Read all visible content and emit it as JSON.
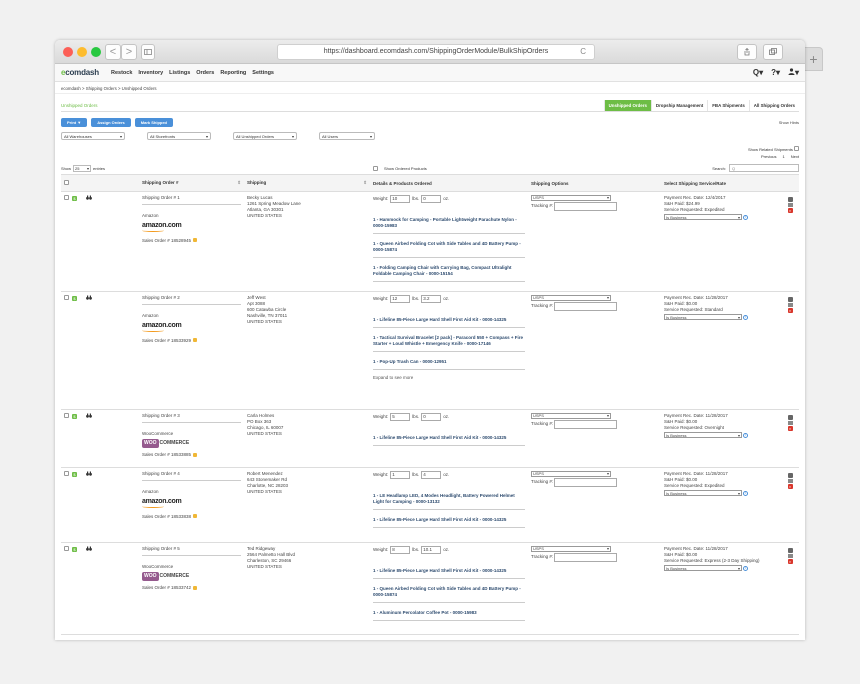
{
  "browser": {
    "url": "https://dashboard.ecomdash.com/ShippingOrderModule/BulkShipOrders",
    "back_icon": "<",
    "forward_icon": ">",
    "reload_icon": "C",
    "newtab_icon": "+"
  },
  "app": {
    "logo_prefix": "e",
    "logo_rest": "comdash",
    "menu": [
      "Restock",
      "Inventory",
      "Listings",
      "Orders",
      "Reporting",
      "Settings"
    ],
    "search_icon": "Q",
    "help_icon": "?",
    "user_icon": "person-icon"
  },
  "breadcrumb": "ecomdash  >  Shipping Orders  >  Unshipped Orders",
  "page": {
    "title": "Unshipped Orders",
    "tabs": [
      "Unshipped Orders",
      "Dropship Management",
      "FBA Shipments",
      "All Shipping Orders"
    ],
    "active_tab": 0,
    "buttons": {
      "print": "Print ▼",
      "assign": "Assign Orders",
      "mark": "Mark Shipped"
    },
    "show_hints": "Show Hints",
    "filters": [
      "All Warehouses",
      "All Storefronts",
      "All Unshipped Orders",
      "All Users"
    ],
    "show_related": "Show Related Shipments",
    "pager": {
      "previous": "Previous",
      "page": "1",
      "next": "Next"
    },
    "show_label": "Show",
    "show_value": "25",
    "entries_label": "entries",
    "show_ordered": "Show Ordered Products",
    "search_label": "Search:",
    "search_placeholder": "Q"
  },
  "table": {
    "headers": [
      "Shipping Order #",
      "Shipping",
      "Details & Products Ordered",
      "Shipping Options",
      "Select Shipping Service/Rate"
    ],
    "weight_label": "Weight:",
    "lbs_label": "lbs.",
    "oz_label": "oz.",
    "tracking_label": "Tracking #:",
    "expand_label": "Expand to see more",
    "rows": [
      {
        "order": "Shipping Order # 1",
        "marketplace": "Amazon",
        "logo": "amazon",
        "logo_text": "amazon.com",
        "sales_order": "Sales Order # 18528945",
        "address": [
          "Becky Lucas",
          "1261 Spring Meadow Lane",
          "Atlanta, GA 30301",
          "UNITED STATES"
        ],
        "lbs": "10",
        "oz": "0",
        "products": [
          "1 - Hammock for Camping - Portable Lightweight Parachute Nylon - 0000-15983",
          "1 - Queen Airbed Folding Cot with Side Tables and 4D Battery Pump - 0000-15874",
          "1 - Folding Camping Chair with Carrying Bag, Compact Ultralight Foldable Camping Chair - 0000-15154"
        ],
        "expand": false,
        "carrier": "USPS",
        "rate": [
          "Payment Rec. Date: 12/4/2017",
          "S&H Paid: $24.99",
          "Service Requested: Expedited"
        ],
        "service": "Is Business"
      },
      {
        "order": "Shipping Order # 2",
        "marketplace": "Amazon",
        "logo": "amazon",
        "logo_text": "amazon.com",
        "sales_order": "Sales Order # 18533929",
        "address": [
          "Jeff West",
          "Apt 3088",
          "600 Catawba Circle",
          "Nashville, TN 37011",
          "UNITED STATES"
        ],
        "lbs": "12",
        "oz": "3.2",
        "products": [
          "1 - Lifeline 85-Piece Large Hard Shell First Aid Kit - 0000-14325",
          "1 - Tactical Survival Bracelet [2 pack] - Paracord 550 + Compass + Fire Starter + Loud Whistle + Emergency Knife - 0000-17146",
          "1 - Pop-Up Trash Can - 0000-12951"
        ],
        "expand": true,
        "carrier": "USPS",
        "rate": [
          "Payment Rec. Date: 11/28/2017",
          "S&H Paid: $0.00",
          "Service Requested: Standard"
        ],
        "service": "Is Business"
      },
      {
        "order": "Shipping Order # 3",
        "marketplace": "WooCommerce",
        "logo": "woo",
        "logo_text": "WOO",
        "logo_text2": "COMMERCE",
        "sales_order": "Sales Order # 18533885",
        "address": [
          "Carla Holmes",
          "PO Box 363",
          "Chicago, IL 60007",
          "UNITED STATES"
        ],
        "lbs": "5",
        "oz": "0",
        "products": [
          "1 - Lifeline 85-Piece Large Hard Shell First Aid Kit - 0000-14325"
        ],
        "expand": false,
        "carrier": "USPS",
        "rate": [
          "Payment Rec. Date: 11/28/2017",
          "S&H Paid: $0.00",
          "Service Requested: Overnight"
        ],
        "service": "Is Business"
      },
      {
        "order": "Shipping Order # 4",
        "marketplace": "Amazon",
        "logo": "amazon",
        "logo_text": "amazon.com",
        "sales_order": "Sales Order # 18533838",
        "address": [
          "Robert Menendez",
          "643 Stonemaker Rd",
          "Charlotte, NC 28203",
          "UNITED STATES"
        ],
        "lbs": "1",
        "oz": "4",
        "products": [
          "1 - LE Headlamp LED, 4 Modes Headlight, Battery Powered Helmet Light for Camping - 0000-13132",
          "1 - Lifeline 85-Piece Large Hard Shell First Aid Kit - 0000-14325"
        ],
        "expand": false,
        "carrier": "USPS",
        "rate": [
          "Payment Rec. Date: 11/28/2017",
          "S&H Paid: $0.00",
          "Service Requested: Expedited"
        ],
        "service": "Is Business"
      },
      {
        "order": "Shipping Order # 5",
        "marketplace": "WooCommerce",
        "logo": "woo",
        "logo_text": "WOO",
        "logo_text2": "COMMERCE",
        "sales_order": "Sales Order # 18533742",
        "address": [
          "Ted Ridgeway",
          "2564 Palmetto Hall Blvd",
          "Charleston, SC 29466",
          "UNITED STATES"
        ],
        "lbs": "8",
        "oz": "10.1",
        "products": [
          "1 - Lifeline 85-Piece Large Hard Shell First Aid Kit - 0000-14325",
          "1 - Queen Airbed Folding Cot with Side Tables and 4D Battery Pump - 0000-15874",
          "1 - Aluminum Percolator Coffee Pot - 0000-15983"
        ],
        "expand": false,
        "carrier": "USPS",
        "rate": [
          "Payment Rec. Date: 11/28/2017",
          "S&H Paid: $0.00",
          "Service Requested: Express (2-3 Day Shipping)"
        ],
        "service": "Is Business"
      }
    ]
  },
  "colors": {
    "accent": "#6dbd45",
    "button": "#4a90d9",
    "product_link": "#2c4a6e",
    "delete": "#d9362b"
  }
}
